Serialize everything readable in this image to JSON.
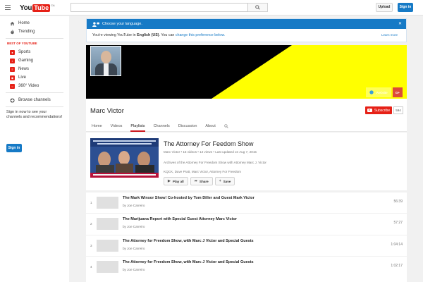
{
  "masthead": {
    "logo_you": "You",
    "logo_tube": "Tube",
    "logo_country": "CA",
    "search_placeholder": "",
    "upload_label": "Upload",
    "signin_label": "Sign in"
  },
  "guide": {
    "items": [
      {
        "label": "Home",
        "icon": "home-icon"
      },
      {
        "label": "Trending",
        "icon": "flame-icon"
      }
    ],
    "section_title": "BEST OF YOUTUBE",
    "categories": [
      {
        "label": "Sports",
        "icon": "sports-icon"
      },
      {
        "label": "Gaming",
        "icon": "gaming-icon"
      },
      {
        "label": "News",
        "icon": "news-icon"
      },
      {
        "label": "Live",
        "icon": "live-icon"
      },
      {
        "label": "360° Video",
        "icon": "360-video-icon"
      }
    ],
    "browse_label": "Browse channels",
    "promo_text": "Sign in now to see your channels and recommendations!",
    "signin_label": "Sign in"
  },
  "language_notice": {
    "title": "Choose your language.",
    "body_prefix": "You're viewing YouTube in ",
    "language": "English (US)",
    "body_middle": ". You can ",
    "change_link": "change this preference below.",
    "learn_more": "Learn more"
  },
  "channel": {
    "name": "Marc Victor",
    "subscribe_label": "Subscribe",
    "subscriber_count": "594",
    "banner_links": {
      "website": "Website",
      "google_plus": "G+"
    },
    "tabs": [
      "Home",
      "Videos",
      "Playlists",
      "Channels",
      "Discussion",
      "About"
    ],
    "active_tab": "Playlists"
  },
  "playlist": {
    "title": "The Attorney For Feedom Show",
    "owner": "Marc Victor",
    "video_count": "15 videos",
    "views": "12 views",
    "updated": "Last updated on Aug 7, 2015",
    "description": "Archives of the Attorney For Freedom Show with Attorney Marc J. Victor",
    "tags": "KQCK, Dave Pratt, Marc Victor, Attorney For Freedom",
    "play_all_label": "Play all",
    "share_label": "Share",
    "save_label": "Save"
  },
  "videos": [
    {
      "index": "1",
      "title": "The Mark Winsor Show! Co-hosted by Tom Diller and Guest Mark Victor",
      "by": "by Joe Carreiro",
      "duration": "56:39"
    },
    {
      "index": "2",
      "title": "The Marijuana Report with Special Guest Attorney Marc Victor",
      "by": "by Joe Carreiro",
      "duration": "57:27"
    },
    {
      "index": "3",
      "title": "The Attorney for Freedom Show, with Marc J Victor and Special Guests",
      "by": "by Joe Carreiro",
      "duration": "1:04:14"
    },
    {
      "index": "4",
      "title": "The Attorney for Freedom Show, with Marc J Victor and Special Guests",
      "by": "by Joe Carreiro",
      "duration": "1:02:17"
    }
  ],
  "colors": {
    "brand_red": "#e62117",
    "accent_blue": "#167ac6",
    "banner_yellow": "#ffff00"
  }
}
